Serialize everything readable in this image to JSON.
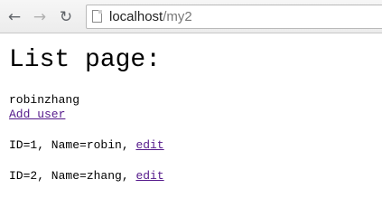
{
  "browser": {
    "back_icon": "arrow-left-icon",
    "forward_icon": "arrow-right-icon",
    "reload_icon": "reload-icon",
    "page_icon": "page-icon",
    "url_host": "localhost",
    "url_path": "/my2"
  },
  "page": {
    "title": "List page:",
    "username": "robinzhang",
    "add_user_label": "Add user",
    "users": [
      {
        "text": "ID=1, Name=robin, ",
        "edit_label": "edit"
      },
      {
        "text": "ID=2, Name=zhang, ",
        "edit_label": "edit"
      }
    ]
  },
  "colors": {
    "visited_link": "#551a8b",
    "url_path": "#777777"
  }
}
